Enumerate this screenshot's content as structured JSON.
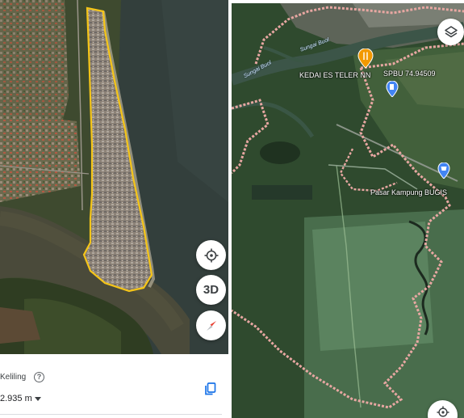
{
  "left_panel": {
    "buttons": {
      "view_3d_label": "3D"
    },
    "measure": {
      "label": "Keliling",
      "help_symbol": "?",
      "value": "2.935 m"
    },
    "icons": {
      "locate": "crosshair-icon",
      "compass": "compass-icon",
      "help": "help-icon",
      "dropdown": "chevron-down-icon",
      "copy": "copy-icon"
    },
    "colors": {
      "measure_outline": "#f5c518",
      "accent": "#1a73e8"
    }
  },
  "right_panel": {
    "labels": {
      "river_1": "Sungai Buol",
      "river_2": "Sungai Buol",
      "restaurant": "KEDAI ES TELER NN",
      "fuel": "SPBU 74.94509",
      "market": "Pasar Kampung BUGIS"
    },
    "icons": {
      "layers": "layers-icon",
      "restaurant_pin": "restaurant-pin-icon",
      "fuel_pin": "fuel-pin-icon",
      "shop_pin": "shopping-pin-icon",
      "locate": "crosshair-icon"
    },
    "colors": {
      "boundary": "#e8a7a2",
      "restaurant_pin": "#f29900",
      "poi_blue": "#4285f4"
    }
  }
}
